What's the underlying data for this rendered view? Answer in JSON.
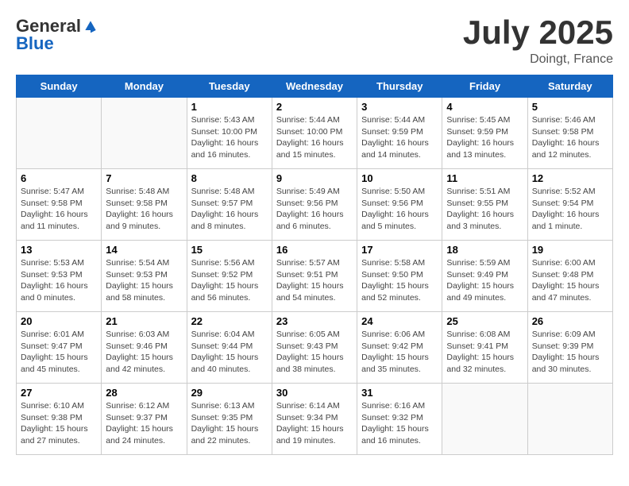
{
  "header": {
    "logo_general": "General",
    "logo_blue": "Blue",
    "month_title": "July 2025",
    "location": "Doingt, France"
  },
  "days_of_week": [
    "Sunday",
    "Monday",
    "Tuesday",
    "Wednesday",
    "Thursday",
    "Friday",
    "Saturday"
  ],
  "weeks": [
    [
      {
        "day": "",
        "info": ""
      },
      {
        "day": "",
        "info": ""
      },
      {
        "day": "1",
        "info": "Sunrise: 5:43 AM\nSunset: 10:00 PM\nDaylight: 16 hours and 16 minutes."
      },
      {
        "day": "2",
        "info": "Sunrise: 5:44 AM\nSunset: 10:00 PM\nDaylight: 16 hours and 15 minutes."
      },
      {
        "day": "3",
        "info": "Sunrise: 5:44 AM\nSunset: 9:59 PM\nDaylight: 16 hours and 14 minutes."
      },
      {
        "day": "4",
        "info": "Sunrise: 5:45 AM\nSunset: 9:59 PM\nDaylight: 16 hours and 13 minutes."
      },
      {
        "day": "5",
        "info": "Sunrise: 5:46 AM\nSunset: 9:58 PM\nDaylight: 16 hours and 12 minutes."
      }
    ],
    [
      {
        "day": "6",
        "info": "Sunrise: 5:47 AM\nSunset: 9:58 PM\nDaylight: 16 hours and 11 minutes."
      },
      {
        "day": "7",
        "info": "Sunrise: 5:48 AM\nSunset: 9:58 PM\nDaylight: 16 hours and 9 minutes."
      },
      {
        "day": "8",
        "info": "Sunrise: 5:48 AM\nSunset: 9:57 PM\nDaylight: 16 hours and 8 minutes."
      },
      {
        "day": "9",
        "info": "Sunrise: 5:49 AM\nSunset: 9:56 PM\nDaylight: 16 hours and 6 minutes."
      },
      {
        "day": "10",
        "info": "Sunrise: 5:50 AM\nSunset: 9:56 PM\nDaylight: 16 hours and 5 minutes."
      },
      {
        "day": "11",
        "info": "Sunrise: 5:51 AM\nSunset: 9:55 PM\nDaylight: 16 hours and 3 minutes."
      },
      {
        "day": "12",
        "info": "Sunrise: 5:52 AM\nSunset: 9:54 PM\nDaylight: 16 hours and 1 minute."
      }
    ],
    [
      {
        "day": "13",
        "info": "Sunrise: 5:53 AM\nSunset: 9:53 PM\nDaylight: 16 hours and 0 minutes."
      },
      {
        "day": "14",
        "info": "Sunrise: 5:54 AM\nSunset: 9:53 PM\nDaylight: 15 hours and 58 minutes."
      },
      {
        "day": "15",
        "info": "Sunrise: 5:56 AM\nSunset: 9:52 PM\nDaylight: 15 hours and 56 minutes."
      },
      {
        "day": "16",
        "info": "Sunrise: 5:57 AM\nSunset: 9:51 PM\nDaylight: 15 hours and 54 minutes."
      },
      {
        "day": "17",
        "info": "Sunrise: 5:58 AM\nSunset: 9:50 PM\nDaylight: 15 hours and 52 minutes."
      },
      {
        "day": "18",
        "info": "Sunrise: 5:59 AM\nSunset: 9:49 PM\nDaylight: 15 hours and 49 minutes."
      },
      {
        "day": "19",
        "info": "Sunrise: 6:00 AM\nSunset: 9:48 PM\nDaylight: 15 hours and 47 minutes."
      }
    ],
    [
      {
        "day": "20",
        "info": "Sunrise: 6:01 AM\nSunset: 9:47 PM\nDaylight: 15 hours and 45 minutes."
      },
      {
        "day": "21",
        "info": "Sunrise: 6:03 AM\nSunset: 9:46 PM\nDaylight: 15 hours and 42 minutes."
      },
      {
        "day": "22",
        "info": "Sunrise: 6:04 AM\nSunset: 9:44 PM\nDaylight: 15 hours and 40 minutes."
      },
      {
        "day": "23",
        "info": "Sunrise: 6:05 AM\nSunset: 9:43 PM\nDaylight: 15 hours and 38 minutes."
      },
      {
        "day": "24",
        "info": "Sunrise: 6:06 AM\nSunset: 9:42 PM\nDaylight: 15 hours and 35 minutes."
      },
      {
        "day": "25",
        "info": "Sunrise: 6:08 AM\nSunset: 9:41 PM\nDaylight: 15 hours and 32 minutes."
      },
      {
        "day": "26",
        "info": "Sunrise: 6:09 AM\nSunset: 9:39 PM\nDaylight: 15 hours and 30 minutes."
      }
    ],
    [
      {
        "day": "27",
        "info": "Sunrise: 6:10 AM\nSunset: 9:38 PM\nDaylight: 15 hours and 27 minutes."
      },
      {
        "day": "28",
        "info": "Sunrise: 6:12 AM\nSunset: 9:37 PM\nDaylight: 15 hours and 24 minutes."
      },
      {
        "day": "29",
        "info": "Sunrise: 6:13 AM\nSunset: 9:35 PM\nDaylight: 15 hours and 22 minutes."
      },
      {
        "day": "30",
        "info": "Sunrise: 6:14 AM\nSunset: 9:34 PM\nDaylight: 15 hours and 19 minutes."
      },
      {
        "day": "31",
        "info": "Sunrise: 6:16 AM\nSunset: 9:32 PM\nDaylight: 15 hours and 16 minutes."
      },
      {
        "day": "",
        "info": ""
      },
      {
        "day": "",
        "info": ""
      }
    ]
  ]
}
